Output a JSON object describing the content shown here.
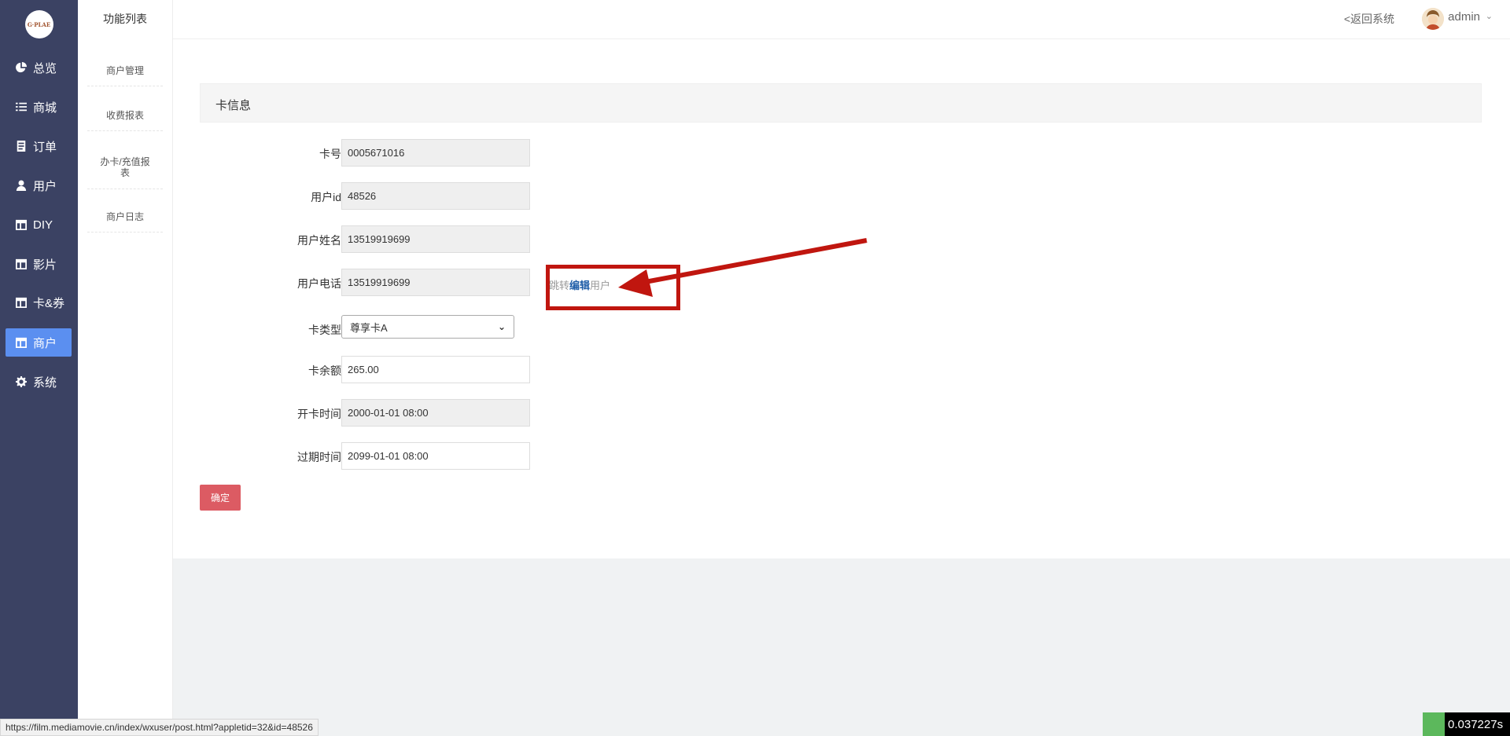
{
  "sidebar": {
    "logo_text": "G·PLAE",
    "items": [
      {
        "label": "总览",
        "icon": "pie-chart-icon"
      },
      {
        "label": "商城",
        "icon": "list-icon"
      },
      {
        "label": "订单",
        "icon": "document-icon"
      },
      {
        "label": "用户",
        "icon": "user-icon"
      },
      {
        "label": "DIY",
        "icon": "layout-icon"
      },
      {
        "label": "影片",
        "icon": "layout-icon"
      },
      {
        "label": "卡&券",
        "icon": "layout-icon"
      },
      {
        "label": "商户",
        "icon": "layout-icon",
        "active": true
      },
      {
        "label": "系统",
        "icon": "gear-icon"
      }
    ]
  },
  "subnav": {
    "title": "功能列表",
    "items": [
      "商户管理",
      "收费报表",
      "办卡/充值报表",
      "商户日志"
    ]
  },
  "topbar": {
    "back_label": "<返回系统",
    "user_name": "admin"
  },
  "section": {
    "title": "卡信息"
  },
  "form": {
    "card_no_label": "卡号",
    "card_no": "0005671016",
    "user_id_label": "用户id",
    "user_id": "48526",
    "user_name_label": "用户姓名",
    "user_name": "13519919699",
    "user_phone_label": "用户电话",
    "user_phone": "13519919699",
    "jump_prefix": "跳转",
    "jump_edit": "编辑",
    "jump_suffix": "用户",
    "card_type_label": "卡类型",
    "card_type": "尊享卡A",
    "balance_label": "卡余额",
    "balance": "265.00",
    "open_time_label": "开卡时间",
    "open_time": "2000-01-01 08:00",
    "expire_label": "过期时间",
    "expire_time": "2099-01-01 08:00",
    "confirm_label": "确定"
  },
  "status": {
    "url": "https://film.mediamovie.cn/index/wxuser/post.html?appletid=32&id=48526",
    "timer": "0.037227s"
  },
  "colors": {
    "sidebar_bg": "#3b4263",
    "active_nav": "#5b8ff0",
    "confirm_button": "#dc5b63",
    "annotation_red": "#c0160f"
  }
}
